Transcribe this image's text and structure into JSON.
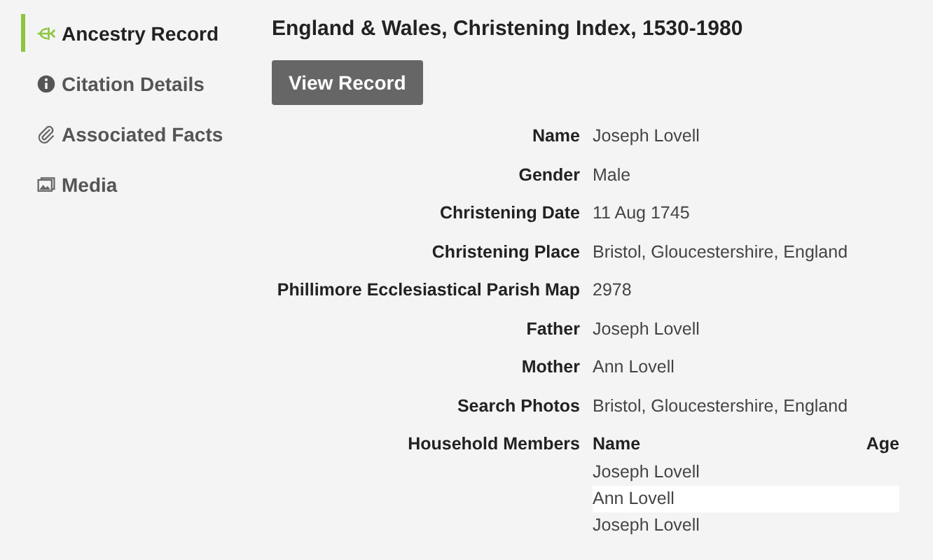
{
  "sidebar": {
    "items": [
      {
        "label": "Ancestry Record",
        "kind": "sprout",
        "selected": true
      },
      {
        "label": "Citation Details",
        "kind": "info",
        "selected": false
      },
      {
        "label": "Associated Facts",
        "kind": "paperclip",
        "selected": false
      },
      {
        "label": "Media",
        "kind": "photos",
        "selected": false
      }
    ]
  },
  "title": "England & Wales, Christening Index, 1530-1980",
  "view_button": "View Record",
  "fields": [
    {
      "label": "Name",
      "value": "Joseph Lovell"
    },
    {
      "label": "Gender",
      "value": "Male"
    },
    {
      "label": "Christening Date",
      "value": "11 Aug 1745"
    },
    {
      "label": "Christening Place",
      "value": "Bristol, Gloucestershire, England"
    },
    {
      "label": "Phillimore Ecclesiastical Parish Map",
      "value": "2978"
    },
    {
      "label": "Father",
      "value": "Joseph Lovell"
    },
    {
      "label": "Mother",
      "value": "Ann Lovell"
    },
    {
      "label": "Search Photos",
      "value": "Bristol, Gloucestershire, England"
    }
  ],
  "household": {
    "label": "Household Members",
    "columns": [
      "Name",
      "Age"
    ],
    "rows": [
      {
        "name": "Joseph Lovell"
      },
      {
        "name": "Ann Lovell"
      },
      {
        "name": "Joseph Lovell"
      }
    ]
  }
}
